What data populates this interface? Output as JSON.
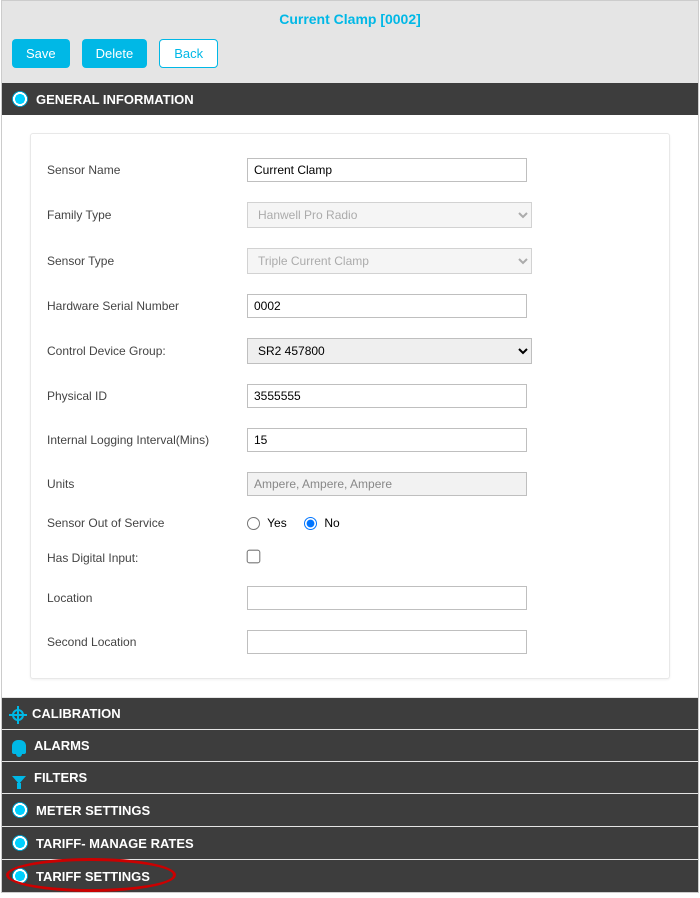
{
  "title": "Current Clamp [0002]",
  "buttons": {
    "save": "Save",
    "delete": "Delete",
    "back": "Back"
  },
  "sections": {
    "general": {
      "label": "GENERAL INFORMATION"
    },
    "calibration": {
      "label": "CALIBRATION"
    },
    "alarms": {
      "label": "ALARMS"
    },
    "filters": {
      "label": "FILTERS"
    },
    "meter": {
      "label": "METER SETTINGS"
    },
    "tariff_rates": {
      "label": "TARIFF- MANAGE RATES"
    },
    "tariff_settings": {
      "label": "TARIFF SETTINGS"
    }
  },
  "form": {
    "sensor_name": {
      "label": "Sensor Name",
      "value": "Current Clamp"
    },
    "family_type": {
      "label": "Family Type",
      "value": "Hanwell Pro Radio"
    },
    "sensor_type": {
      "label": "Sensor Type",
      "value": "Triple Current Clamp"
    },
    "hw_serial": {
      "label": "Hardware Serial Number",
      "value": "0002"
    },
    "ctrl_group": {
      "label": "Control Device Group:",
      "value": "SR2 457800"
    },
    "physical_id": {
      "label": "Physical ID",
      "value": "3555555"
    },
    "log_interval": {
      "label": "Internal Logging Interval(Mins)",
      "value": "15"
    },
    "units": {
      "label": "Units",
      "value": "Ampere, Ampere, Ampere"
    },
    "out_of_service": {
      "label": "Sensor Out of Service",
      "yes": "Yes",
      "no": "No",
      "value": "No"
    },
    "has_digital": {
      "label": "Has Digital Input:",
      "checked": false
    },
    "location": {
      "label": "Location",
      "value": ""
    },
    "second_location": {
      "label": "Second Location",
      "value": ""
    }
  }
}
